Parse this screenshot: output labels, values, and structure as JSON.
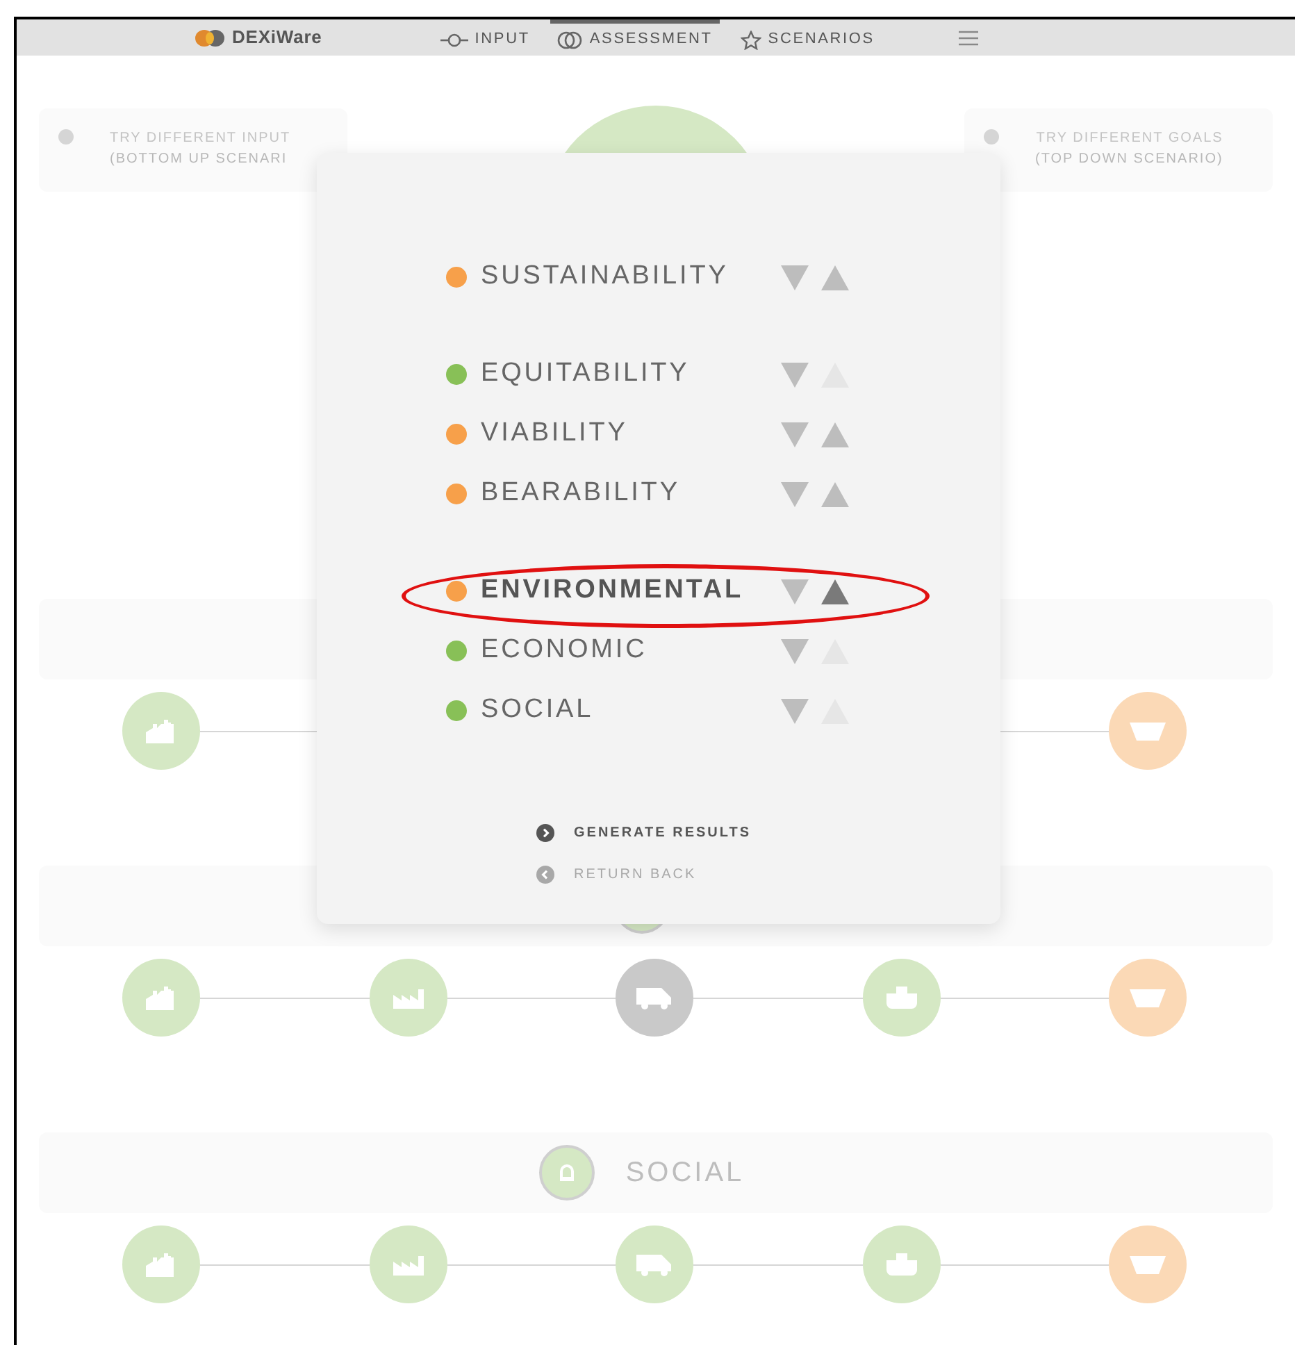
{
  "nav": {
    "brand": "DEXiWare",
    "items": [
      {
        "label": "INPUT",
        "kind": "input",
        "selected": false
      },
      {
        "label": "ASSESSMENT",
        "kind": "rings",
        "selected": true
      },
      {
        "label": "SCENARIOS",
        "kind": "star",
        "selected": false
      }
    ]
  },
  "scenario_cards": [
    {
      "title": "TRY DIFFERENT INPUT",
      "subtitle": "(BOTTOM UP SCENARI"
    },
    {
      "title": "TRY DIFFERENT GOALS",
      "subtitle": "(TOP DOWN SCENARIO)"
    }
  ],
  "sections": [
    {
      "icon_visible": false,
      "nodes": [
        {
          "kind": "smokestack",
          "color": "#d5e8c4"
        },
        {
          "kind": "bowl",
          "color": "#fbd9b6"
        }
      ]
    },
    {
      "icon_visible": true,
      "nodes": [
        {
          "kind": "smokestack",
          "color": "#d5e8c4"
        },
        {
          "kind": "factory",
          "color": "#d5e8c4"
        },
        {
          "kind": "truck",
          "color": "#c9c9c9"
        },
        {
          "kind": "ship",
          "color": "#d5e8c4"
        },
        {
          "kind": "bowl",
          "color": "#fbd9b6"
        }
      ]
    },
    {
      "icon_visible": true,
      "label": "SOCIAL",
      "nodes": [
        {
          "kind": "smokestack",
          "color": "#d5e8c4"
        },
        {
          "kind": "factory",
          "color": "#d5e8c4"
        },
        {
          "kind": "truck",
          "color": "#d5e8c4"
        },
        {
          "kind": "ship",
          "color": "#d5e8c4"
        },
        {
          "kind": "bowl",
          "color": "#fbd9b6"
        }
      ]
    }
  ],
  "dialog": {
    "groups": [
      {
        "items": [
          {
            "label": "SUSTAINABILITY",
            "color": "#f7a04a",
            "selected": false,
            "up_enabled": true,
            "up_active": false
          }
        ]
      },
      {
        "items": [
          {
            "label": "EQUITABILITY",
            "color": "#88c057",
            "selected": false,
            "up_enabled": false,
            "up_active": false
          },
          {
            "label": "VIABILITY",
            "color": "#f7a04a",
            "selected": false,
            "up_enabled": true,
            "up_active": false
          },
          {
            "label": "BEARABILITY",
            "color": "#f7a04a",
            "selected": false,
            "up_enabled": true,
            "up_active": false
          }
        ]
      },
      {
        "items": [
          {
            "label": "ENVIRONMENTAL",
            "color": "#f7a04a",
            "selected": true,
            "up_enabled": true,
            "up_active": true
          },
          {
            "label": "ECONOMIC",
            "color": "#88c057",
            "selected": false,
            "up_enabled": false,
            "up_active": false
          },
          {
            "label": "SOCIAL",
            "color": "#88c057",
            "selected": false,
            "up_enabled": false,
            "up_active": false
          }
        ]
      }
    ],
    "actions": [
      {
        "label": "GENERATE RESULTS",
        "kind": "forward"
      },
      {
        "label": "RETURN BACK",
        "kind": "back"
      }
    ]
  }
}
